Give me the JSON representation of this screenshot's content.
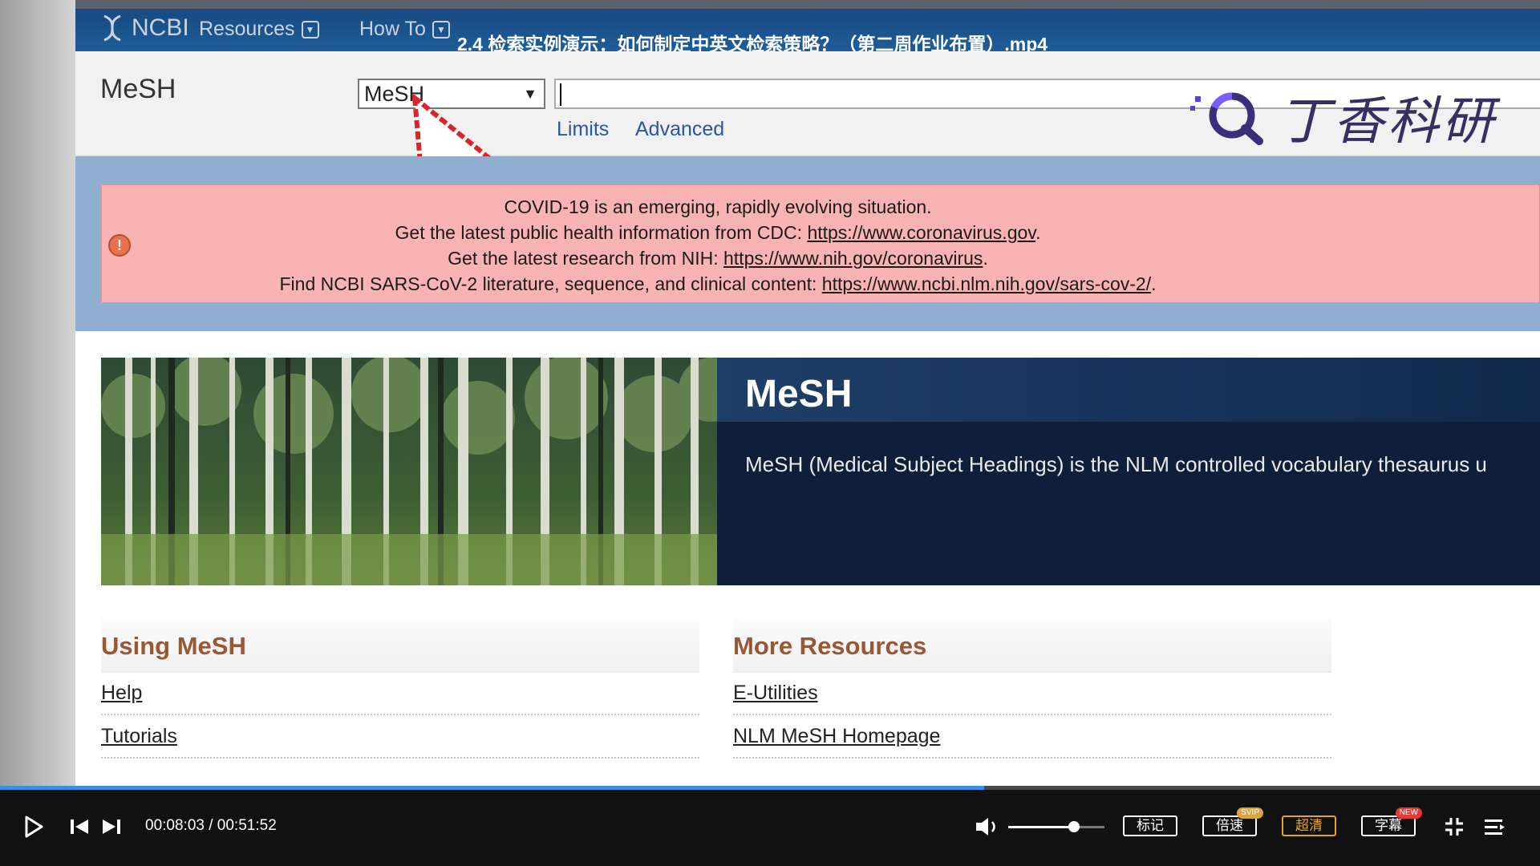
{
  "nav": {
    "logo_text": "NCBI",
    "resources": "Resources",
    "how_to": "How To",
    "video_title": "2.4 检索实例演示：如何制定中英文检索策略？（第二周作业布置）.mp4"
  },
  "search": {
    "db_title": "MeSH",
    "db_selected": "MeSH",
    "query": "",
    "limits": "Limits",
    "advanced": "Advanced"
  },
  "watermark": {
    "brand_text": "丁香科研"
  },
  "alert": {
    "line1": "COVID-19 is an emerging, rapidly evolving situation.",
    "line2_prefix": "Get the latest public health information from CDC:",
    "line2_link": "https://www.coronavirus.gov",
    "line2_suffix": ".",
    "line3_prefix": "Get the latest research from NIH:",
    "line3_link": "https://www.nih.gov/coronavirus",
    "line3_suffix": ".",
    "line4_prefix": "Find NCBI SARS-CoV-2 literature, sequence, and clinical content:",
    "line4_link": "https://www.ncbi.nlm.nih.gov/sars-cov-2/",
    "line4_suffix": "."
  },
  "hero": {
    "title": "MeSH",
    "description": "MeSH (Medical Subject Headings) is the NLM controlled vocabulary thesaurus u"
  },
  "using": {
    "title": "Using MeSH",
    "links": [
      "Help",
      "Tutorials"
    ]
  },
  "resources": {
    "title": "More Resources",
    "links": [
      "E-Utilities",
      "NLM MeSH Homepage"
    ]
  },
  "player": {
    "time": "00:08:03 / 00:51:52",
    "progress": 0.639,
    "volume": 0.68,
    "buttons": {
      "mark": "标记",
      "speed": "倍速",
      "speed_tag": "SVIP",
      "quality": "超清",
      "subtitle": "字幕",
      "subtitle_tag": "NEW"
    }
  },
  "colors": {
    "ncbi_bar": "#1f5d99",
    "alert_bg": "#f9b3b3",
    "hero_bg": "#0f1e39",
    "section_title": "#985735",
    "link": "#2b55a7",
    "progress": "#3a8ee6",
    "gold": "#e2a62a"
  }
}
